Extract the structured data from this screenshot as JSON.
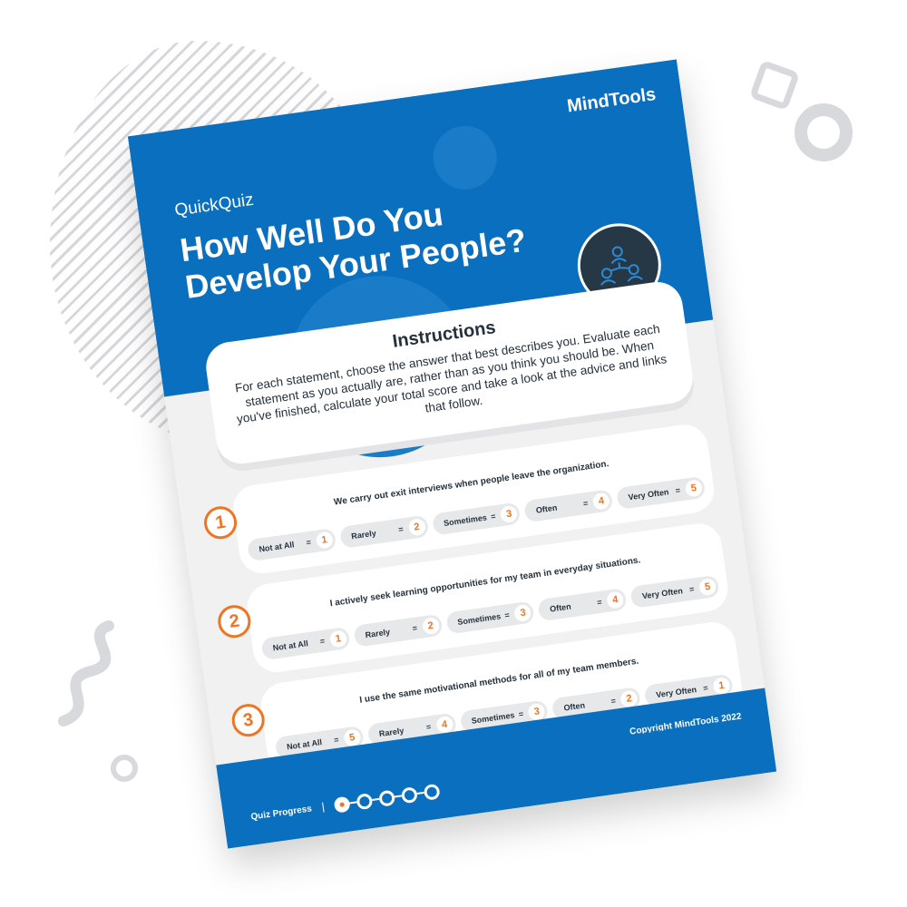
{
  "brand": {
    "logo": "MindTools",
    "accent": "#f07421",
    "primary": "#0a6fbf"
  },
  "header": {
    "kicker": "QuickQuiz",
    "title": "How Well Do You Develop Your People?",
    "icon": "team-network-icon"
  },
  "instructions": {
    "heading": "Instructions",
    "text": "For each statement, choose the answer that best describes you. Evaluate each statement as you actually are, rather than as you think you should be. When you've finished, calculate your total score and take a look at the advice and links that follow."
  },
  "questions": [
    {
      "number": "1",
      "statement": "We carry out exit interviews when people leave the organization.",
      "options": [
        {
          "label": "Not at All",
          "value": "1"
        },
        {
          "label": "Rarely",
          "value": "2"
        },
        {
          "label": "Sometimes",
          "value": "3"
        },
        {
          "label": "Often",
          "value": "4"
        },
        {
          "label": "Very Often",
          "value": "5"
        }
      ]
    },
    {
      "number": "2",
      "statement": "I actively seek learning opportunities for my team in everyday situations.",
      "options": [
        {
          "label": "Not at All",
          "value": "1"
        },
        {
          "label": "Rarely",
          "value": "2"
        },
        {
          "label": "Sometimes",
          "value": "3"
        },
        {
          "label": "Often",
          "value": "4"
        },
        {
          "label": "Very Often",
          "value": "5"
        }
      ]
    },
    {
      "number": "3",
      "statement": "I use the same motivational methods for all of my team members.",
      "options": [
        {
          "label": "Not at All",
          "value": "5"
        },
        {
          "label": "Rarely",
          "value": "4"
        },
        {
          "label": "Sometimes",
          "value": "3"
        },
        {
          "label": "Often",
          "value": "2"
        },
        {
          "label": "Very Often",
          "value": "1"
        }
      ]
    }
  ],
  "equals": "=",
  "copyright": "Copyright MindTools 2022",
  "footer": {
    "progress_label": "Quiz Progress",
    "progress_step": 1,
    "progress_total": 5
  }
}
